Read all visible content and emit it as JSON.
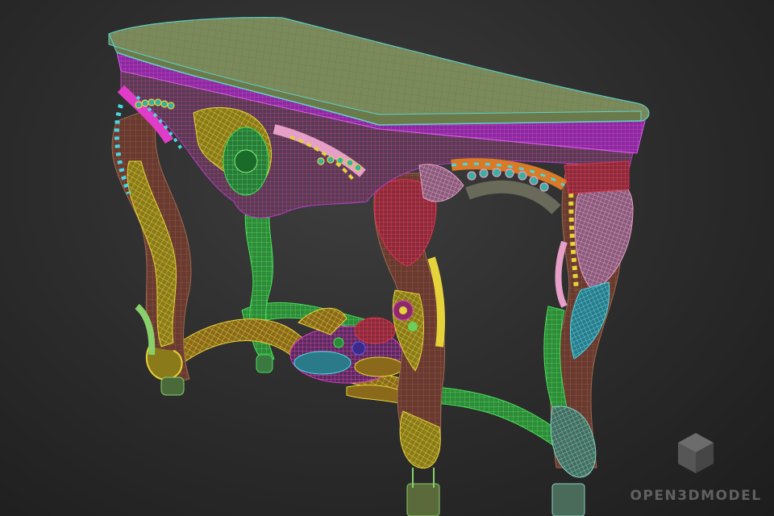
{
  "scene": {
    "subject": "wireframe-3d-model-ornate-console-table",
    "background_color": "#2a2a2a",
    "wire_colors": {
      "tabletop": "#8c9a6a",
      "tabletop_edge": "#5fd0c8",
      "apron": "#b43cc8",
      "carving_yellow": "#e6d23a",
      "carving_green": "#39c94a",
      "carving_magenta": "#e03cc8",
      "carving_pink": "#e6a0c8",
      "carving_cyan": "#4ad8e0",
      "carving_red": "#d8324a",
      "carving_orange": "#d87a28",
      "leg_brown": "#7a4a3a"
    }
  },
  "watermark": {
    "text": "OPEN3DMODEL",
    "icon": "cube-logo-icon"
  }
}
